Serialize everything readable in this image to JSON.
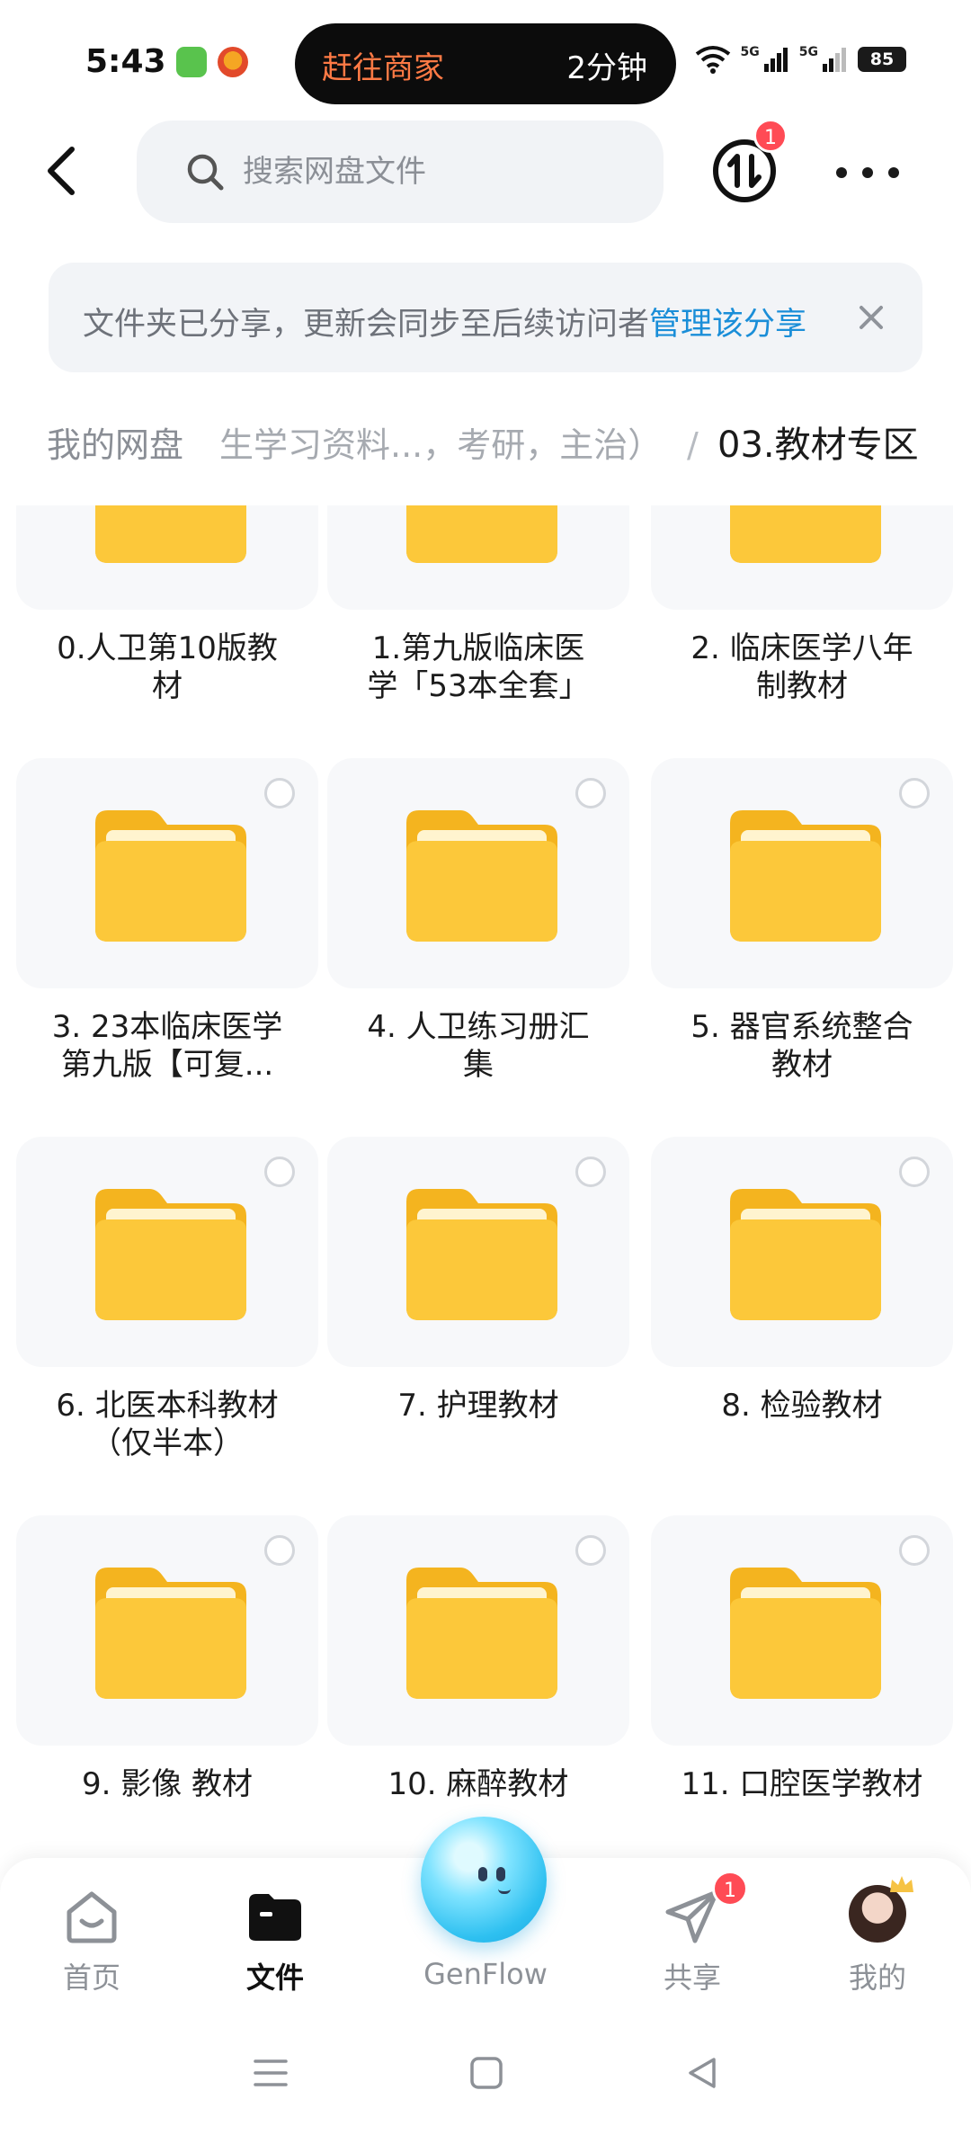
{
  "status_bar": {
    "time": "5:43",
    "live_destination": "赶往商家",
    "live_eta": "2分钟",
    "signal_1": "5G",
    "signal_2": "5G",
    "battery": "85"
  },
  "search": {
    "placeholder": "搜索网盘文件"
  },
  "transfer_badge": "1",
  "share_notice": {
    "text": "文件夹已分享，更新会同步至后续访问者",
    "link": "管理该分享"
  },
  "breadcrumb": {
    "root": "我的网盘",
    "middle": "生学习资料...，考研，主治）",
    "separator": "/",
    "current": "03.教材专区"
  },
  "folders": [
    {
      "line1": "0.人卫第10版教",
      "line2": "材"
    },
    {
      "line1": "1.第九版临床医",
      "line2": "学「53本全套」"
    },
    {
      "line1": "2. 临床医学八年",
      "line2": "制教材"
    },
    {
      "line1": "3. 23本临床医学",
      "line2": "第九版【可复..."
    },
    {
      "line1": "4. 人卫练习册汇",
      "line2": "集"
    },
    {
      "line1": "5. 器官系统整合",
      "line2": "教材"
    },
    {
      "line1": "6. 北医本科教材",
      "line2": "（仅半本）"
    },
    {
      "line1": "7. 护理教材",
      "line2": ""
    },
    {
      "line1": "8. 检验教材",
      "line2": ""
    },
    {
      "line1": "9. 影像 教材",
      "line2": ""
    },
    {
      "line1": "10. 麻醉教材",
      "line2": ""
    },
    {
      "line1": "11. 口腔医学教材",
      "line2": ""
    }
  ],
  "bottom_nav": {
    "home": "首页",
    "files": "文件",
    "genflow": "GenFlow",
    "share": "共享",
    "share_badge": "1",
    "mine": "我的"
  },
  "colors": {
    "accent_link": "#1a8ed8",
    "folder_yellow": "#fcc83a",
    "badge_red": "#ff4b55"
  }
}
